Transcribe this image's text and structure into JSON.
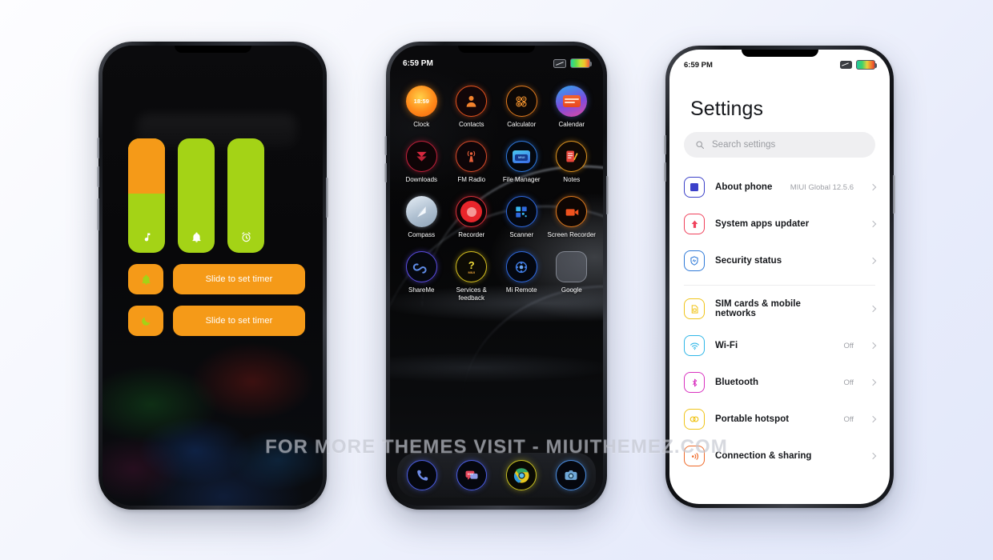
{
  "background": {
    "from": "#fdfdff",
    "to": "#e2e8fa"
  },
  "watermark": {
    "text": "FOR MORE THEMES VISIT - MIUITHEMEZ.COM"
  },
  "phone1": {
    "name": "clock-timer-screen",
    "accent_orange": "#f59a18",
    "accent_green": "#a4d316",
    "bars": [
      {
        "id": "music-volume",
        "icon": "music-note-icon",
        "fill_percent": 52,
        "top_color": "#f59a18",
        "bottom_color": "#a4d316"
      },
      {
        "id": "ring-volume",
        "icon": "bell-icon",
        "fill_percent": 100,
        "top_color": "#a4d316",
        "bottom_color": "#a4d316"
      },
      {
        "id": "alarm-volume",
        "icon": "alarm-clock-icon",
        "fill_percent": 100,
        "top_color": "#a4d316",
        "bottom_color": "#a4d316"
      }
    ],
    "sliders": [
      {
        "id": "alarm-slider",
        "icon": "bell-icon",
        "label": "Slide to set timer"
      },
      {
        "id": "night-slider",
        "icon": "moon-icon",
        "label": "Slide to set timer"
      }
    ]
  },
  "phone2": {
    "name": "home-screen",
    "status": {
      "time": "6:59 PM",
      "sim": "no-sim-icon",
      "battery": "battery-icon"
    },
    "apps": [
      {
        "label": "Clock",
        "icon": "clock-icon",
        "badge": "18:59"
      },
      {
        "label": "Contacts",
        "icon": "contacts-icon"
      },
      {
        "label": "Calculator",
        "icon": "calculator-icon"
      },
      {
        "label": "Calendar",
        "icon": "calendar-icon"
      },
      {
        "label": "Downloads",
        "icon": "downloads-icon"
      },
      {
        "label": "FM Radio",
        "icon": "fm-radio-icon"
      },
      {
        "label": "File Manager",
        "icon": "file-manager-icon"
      },
      {
        "label": "Notes",
        "icon": "notes-icon"
      },
      {
        "label": "Compass",
        "icon": "compass-icon"
      },
      {
        "label": "Recorder",
        "icon": "recorder-icon"
      },
      {
        "label": "Scanner",
        "icon": "scanner-icon"
      },
      {
        "label": "Screen Recorder",
        "icon": "screen-recorder-icon"
      },
      {
        "label": "ShareMe",
        "icon": "shareme-icon"
      },
      {
        "label": "Services & feedback",
        "icon": "services-feedback-icon",
        "badge": "?"
      },
      {
        "label": "Mi Remote",
        "icon": "mi-remote-icon"
      },
      {
        "label": "Google",
        "icon": "google-folder-icon"
      }
    ],
    "dock": [
      {
        "label": "Phone",
        "icon": "phone-icon"
      },
      {
        "label": "Messages",
        "icon": "messages-icon"
      },
      {
        "label": "Chrome",
        "icon": "chrome-icon"
      },
      {
        "label": "Camera",
        "icon": "camera-icon"
      }
    ]
  },
  "phone3": {
    "name": "settings-screen",
    "status": {
      "time": "6:59 PM",
      "sim": "no-sim-icon",
      "battery": "battery-icon"
    },
    "title": "Settings",
    "search": {
      "placeholder": "Search settings",
      "icon": "search-icon"
    },
    "groups": [
      {
        "rows": [
          {
            "label": "About phone",
            "value": "MIUI Global 12.5.6",
            "icon": "about-phone-icon",
            "color": "#3b40c9"
          },
          {
            "label": "System apps updater",
            "value": "",
            "icon": "arrow-up-icon",
            "color": "#f0425c"
          },
          {
            "label": "Security status",
            "value": "",
            "icon": "shield-icon",
            "color": "#2f7ad8"
          }
        ]
      },
      {
        "rows": [
          {
            "label": "SIM cards & mobile networks",
            "value": "",
            "icon": "sim-card-icon",
            "color": "#f0c419"
          },
          {
            "label": "Wi-Fi",
            "value": "Off",
            "icon": "wifi-icon",
            "color": "#30b7e8"
          },
          {
            "label": "Bluetooth",
            "value": "Off",
            "icon": "bluetooth-icon",
            "color": "#d932c0"
          },
          {
            "label": "Portable hotspot",
            "value": "Off",
            "icon": "hotspot-icon",
            "color": "#f0c419"
          },
          {
            "label": "Connection & sharing",
            "value": "",
            "icon": "connection-sharing-icon",
            "color": "#ef6a2a"
          }
        ]
      }
    ]
  }
}
